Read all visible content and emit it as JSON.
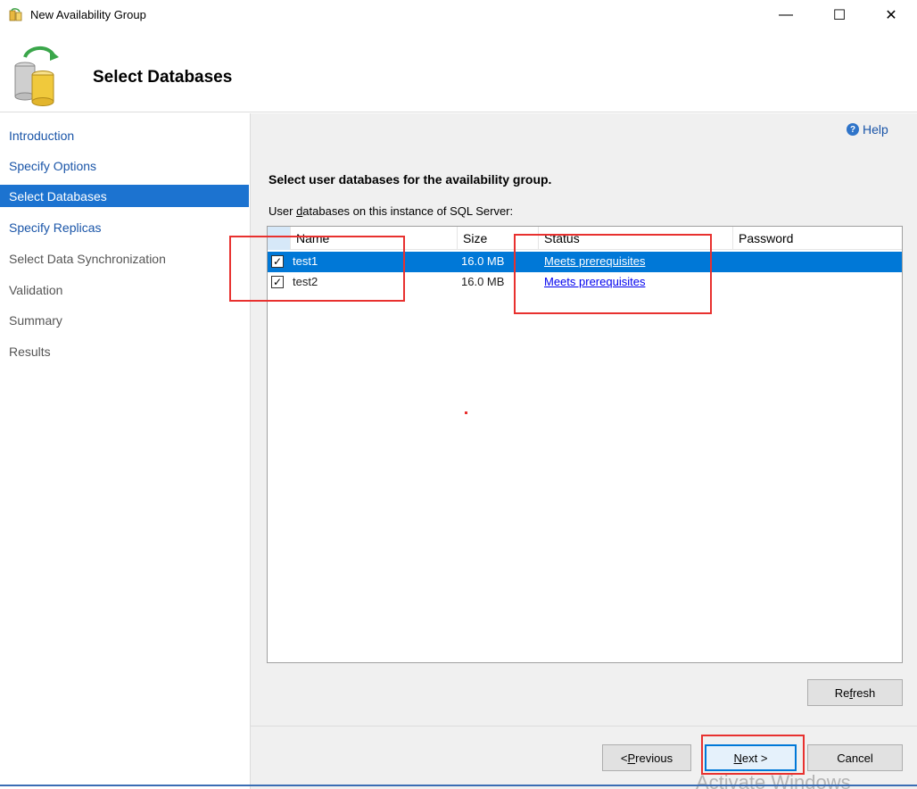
{
  "window": {
    "title": "New Availability Group",
    "minimize_glyph": "—",
    "maximize_glyph": "☐",
    "close_glyph": "✕"
  },
  "header": {
    "title": "Select Databases",
    "icon": "database-wizard-icon"
  },
  "nav": {
    "items": [
      {
        "label": "Introduction",
        "state": "link"
      },
      {
        "label": "Specify Options",
        "state": "link"
      },
      {
        "label": "Select Databases",
        "state": "active"
      },
      {
        "label": "Specify Replicas",
        "state": "link"
      },
      {
        "label": "Select Data Synchronization",
        "state": "muted"
      },
      {
        "label": "Validation",
        "state": "muted"
      },
      {
        "label": "Summary",
        "state": "muted"
      },
      {
        "label": "Results",
        "state": "muted"
      }
    ]
  },
  "help": {
    "label": "Help",
    "icon_glyph": "?"
  },
  "main": {
    "heading": "Select user databases for the availability group.",
    "caption_pre": "User ",
    "caption_accel": "d",
    "caption_post": "atabases on this instance of SQL Server:"
  },
  "grid": {
    "columns": [
      "Name",
      "Size",
      "Status",
      "Password"
    ],
    "rows": [
      {
        "checked": true,
        "name": "test1",
        "size": "16.0 MB",
        "status": "Meets prerequisites",
        "selected": true
      },
      {
        "checked": true,
        "name": "test2",
        "size": "16.0 MB",
        "status": "Meets prerequisites",
        "selected": false
      }
    ],
    "check_glyph": "✓"
  },
  "buttons": {
    "refresh_pre": "Re",
    "refresh_accel": "f",
    "refresh_post": "resh",
    "previous_pre": "< ",
    "previous_accel": "P",
    "previous_post": "revious",
    "next_accel": "N",
    "next_post": "ext >",
    "cancel": "Cancel"
  },
  "watermark": "Activate Windows",
  "colors": {
    "selection": "#0078d7",
    "nav_active": "#1c73d0",
    "link": "#1a55a8",
    "annotation": "#e8312f"
  }
}
